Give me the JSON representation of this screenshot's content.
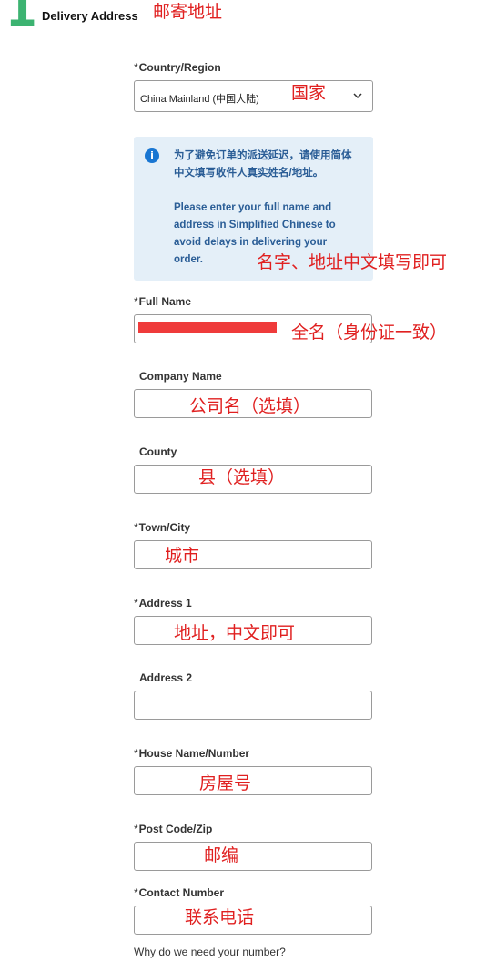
{
  "header": {
    "step_number": "1",
    "title": "Delivery Address",
    "annotation": "邮寄地址"
  },
  "country": {
    "required": "*",
    "label": "Country/Region",
    "value": "China Mainland (中国大陆)",
    "annotation": "国家",
    "icon": "chevron-down-icon"
  },
  "info": {
    "icon": "info-icon",
    "icon_glyph": "i",
    "line1": "为了避免订单的派送延迟，请使用简体",
    "line2": "中文填写收件人真实姓名/地址。",
    "en1": "Please enter your full name and",
    "en2": "address in Simplified Chinese to",
    "en3": "avoid delays in delivering your",
    "en4": "order.",
    "annotation": "名字、地址中文填写即可"
  },
  "full_name": {
    "required": "*",
    "label": "Full Name",
    "annotation": "全名（身份证一致）",
    "value_redacted": true
  },
  "company": {
    "label": "Company Name",
    "annotation": "公司名（选填）"
  },
  "county": {
    "label": "County",
    "annotation": "县（选填）"
  },
  "town": {
    "required": "*",
    "label": "Town/City",
    "annotation": "城市"
  },
  "address1": {
    "required": "*",
    "label": "Address 1",
    "annotation": "地址，中文即可"
  },
  "address2": {
    "label": "Address 2"
  },
  "house": {
    "required": "*",
    "label": "House Name/Number",
    "annotation": "房屋号"
  },
  "postcode": {
    "required": "*",
    "label": "Post Code/Zip",
    "annotation": "邮编"
  },
  "contact": {
    "required": "*",
    "label": "Contact Number",
    "annotation": "联系电话"
  },
  "why_link": "Why do we need your number?",
  "colors": {
    "accent_green": "#3cb371",
    "annotation_red": "#e02020",
    "info_bg": "#e4eff8",
    "info_text": "#2a5d96"
  }
}
